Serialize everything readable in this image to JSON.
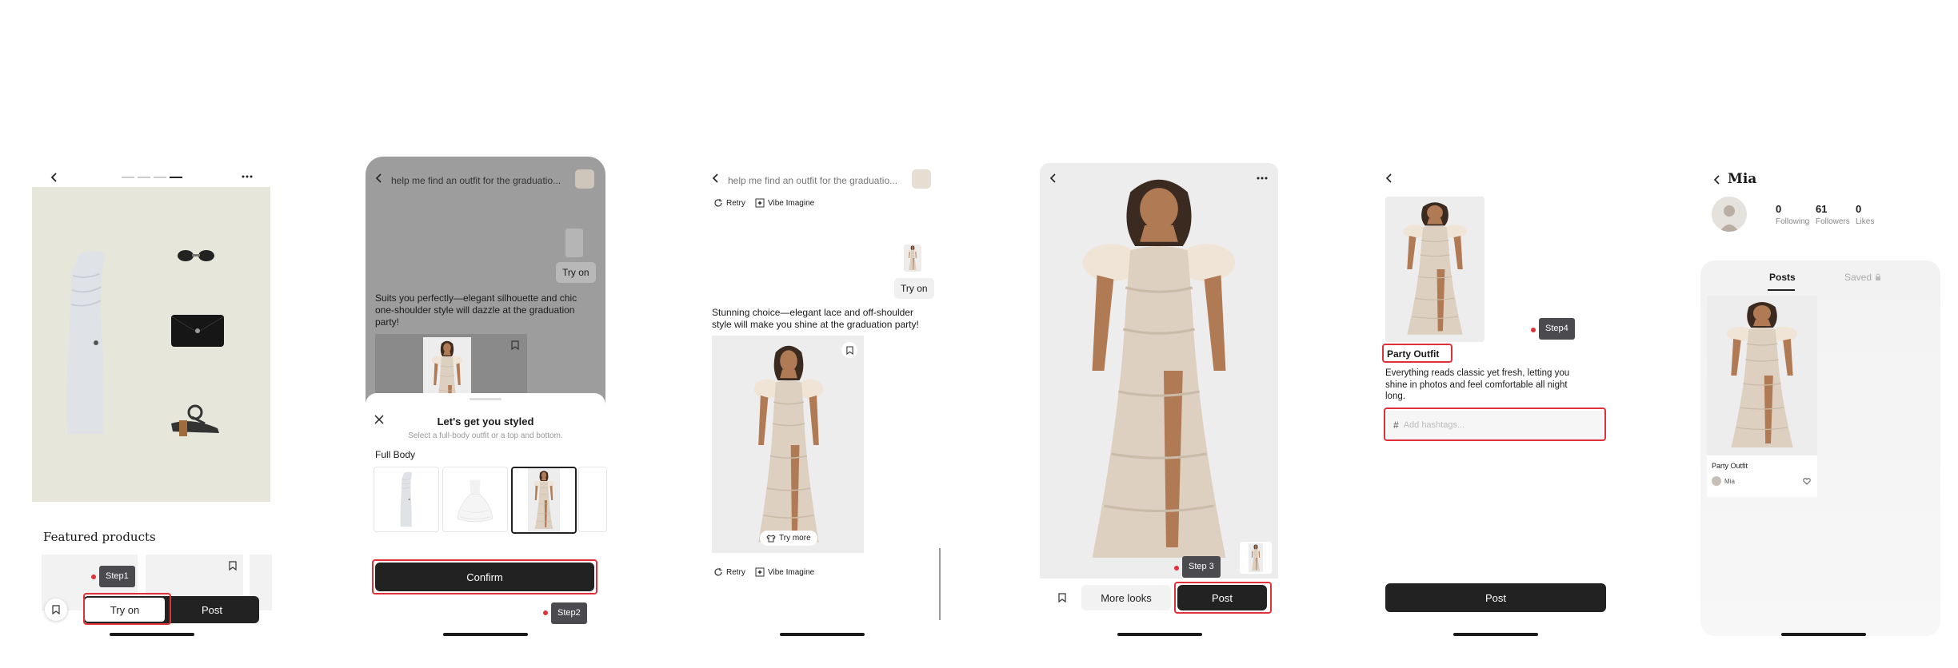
{
  "colors": {
    "accent_red": "#e0313b",
    "dark": "#222222",
    "step_tag_bg": "#4a4a4f",
    "beige_bg": "#e6e7da",
    "chat_bubble": "#f0f0f0"
  },
  "screen1": {
    "featured_title": "Featured products",
    "try_on_label": "Try on",
    "post_label": "Post",
    "step_label": "Step1"
  },
  "screen2": {
    "chat_input": "help me find an outfit for the graduatio...",
    "try_on_chip": "Try on",
    "reply_text": "Suits you perfectly—elegant silhouette and chic one-shoulder style will dazzle at the graduation party!",
    "sheet_title": "Let's get you styled",
    "sheet_subtitle": "Select a full-body outfit or a top and bottom.",
    "section_label": "Full Body",
    "confirm_label": "Confirm",
    "step_label": "Step2"
  },
  "screen3": {
    "chat_input": "help me find an outfit for the graduatio...",
    "retry_label": "Retry",
    "vibe_label": "Vibe Imagine",
    "try_on_chip": "Try on",
    "reply_text": "Stunning choice—elegant lace and off-shoulder style will make you shine at the graduation party!",
    "try_more_label": "Try more",
    "retry_label_2": "Retry",
    "vibe_label_2": "Vibe Imagine"
  },
  "screen4": {
    "more_looks_label": "More looks",
    "post_label": "Post",
    "step_label": "Step 3"
  },
  "screen5": {
    "step_label": "Step4",
    "title": "Party Outfit",
    "description": "Everything reads classic yet fresh, letting you shine in photos and feel comfortable all night long.",
    "hashtag_placeholder": "Add hashtags...",
    "post_label": "Post"
  },
  "screen6": {
    "username": "Mia",
    "stats": [
      {
        "value": "0",
        "label": "Following"
      },
      {
        "value": "61",
        "label": "Followers"
      },
      {
        "value": "0",
        "label": "Likes"
      }
    ],
    "tab_posts": "Posts",
    "tab_saved": "Saved",
    "card_title": "Party Outfit",
    "card_author": "Mia"
  }
}
